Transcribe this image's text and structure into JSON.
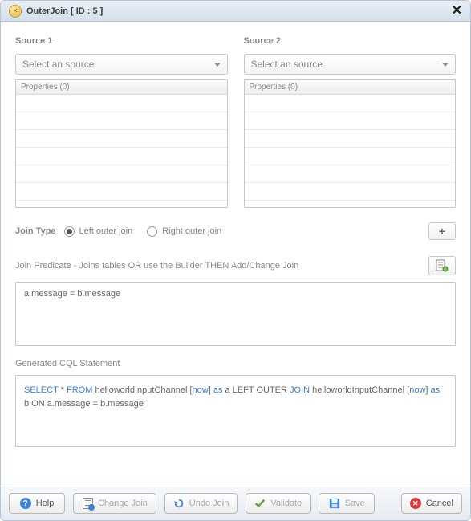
{
  "titlebar": {
    "title": "OuterJoin [ ID : 5 ]"
  },
  "sources": {
    "col1": {
      "label": "Source 1",
      "selectPlaceholder": "Select an source",
      "propsHeader": "Properties (0)"
    },
    "col2": {
      "label": "Source 2",
      "selectPlaceholder": "Select an source",
      "propsHeader": "Properties (0)"
    }
  },
  "joinType": {
    "label": "Join Type",
    "options": {
      "left": "Left outer join",
      "right": "Right outer join"
    },
    "selected": "left",
    "addBtn": "+"
  },
  "predicate": {
    "label": "Join Predicate - Joins tables OR use the Builder THEN Add/Change Join",
    "text": "a.message  =  b.message"
  },
  "cql": {
    "label": "Generated CQL Statement",
    "tokens": [
      {
        "t": "SELECT",
        "k": true
      },
      {
        "t": " * "
      },
      {
        "t": "FROM",
        "k": true
      },
      {
        "t": "   helloworldInputChannel ["
      },
      {
        "t": "now",
        "k": true
      },
      {
        "t": "] "
      },
      {
        "t": "as",
        "k": true
      },
      {
        "t": " a LEFT OUTER "
      },
      {
        "t": "JOIN",
        "k": true
      },
      {
        "t": "   helloworldInputChannel ["
      },
      {
        "t": "now",
        "k": true
      },
      {
        "t": "] "
      },
      {
        "t": "as",
        "k": true
      },
      {
        "t": " b ON a.message  =  b.message"
      }
    ]
  },
  "footer": {
    "help": "Help",
    "change": "Change Join",
    "undo": "Undo Join",
    "validate": "Validate",
    "save": "Save",
    "cancel": "Cancel"
  }
}
